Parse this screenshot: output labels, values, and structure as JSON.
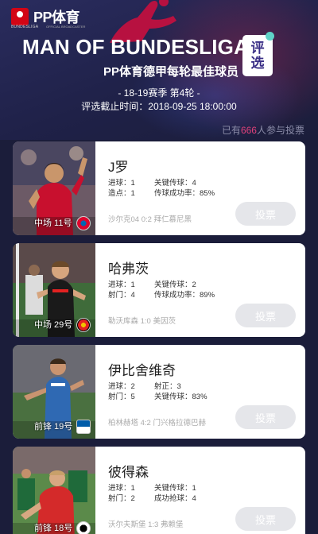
{
  "header": {
    "bundesliga_logo_text": "BUNDESLIGA",
    "brand": "PP体育",
    "brand_sub": "OFFICIAL BROADCASTER",
    "title": "MAN OF BUNDESLIGA",
    "subtitle": "PP体育德甲每轮最佳球员",
    "badge_line1": "评",
    "badge_line2": "选",
    "season": "- 18-19赛季   第4轮 -",
    "deadline": "评选截止时间：2018-09-25 18:00:00",
    "participants_prefix": "已有",
    "participants_count": "666",
    "participants_suffix": "人参与投票"
  },
  "colors": {
    "background": "#1b1d3a",
    "accent_pink": "#e0417a",
    "badge_text": "#3a2f86",
    "badge_dot": "#5fd3c7",
    "vote_button": "#e5e6ea"
  },
  "players": [
    {
      "name": "J罗",
      "position_tag": "中场 11号",
      "club_icon": "bayern-munich-badge",
      "stat1_label": "进球：1",
      "stat1_value": "关键传球：4",
      "stat2_label": "造点：1",
      "stat2_value": "传球成功率：85%",
      "match": "沙尔克04 0:2 拜仁慕尼黑",
      "vote": "投票"
    },
    {
      "name": "哈弗茨",
      "position_tag": "中场 29号",
      "club_icon": "leverkusen-badge",
      "stat1_label": "进球：1",
      "stat1_value": "关键传球：2",
      "stat2_label": "射门：4",
      "stat2_value": "传球成功率：89%",
      "match": "勒沃库森 1:0 美因茨",
      "vote": "投票"
    },
    {
      "name": "伊比舍维奇",
      "position_tag": "前锋 19号",
      "club_icon": "hertha-badge",
      "stat1_label": "进球：2",
      "stat1_value": "射正：3",
      "stat2_label": "射门：5",
      "stat2_value": "关键传球：83%",
      "match": "柏林赫塔 4:2 门兴格拉德巴赫",
      "vote": "投票"
    },
    {
      "name": "彼得森",
      "position_tag": "前锋 18号",
      "club_icon": "freiburg-badge",
      "stat1_label": "进球：1",
      "stat1_value": "关键传球：1",
      "stat2_label": "射门：2",
      "stat2_value": "成功抢球：4",
      "match": "沃尔夫斯堡 1:3 弗赖堡",
      "vote": "投票"
    }
  ]
}
